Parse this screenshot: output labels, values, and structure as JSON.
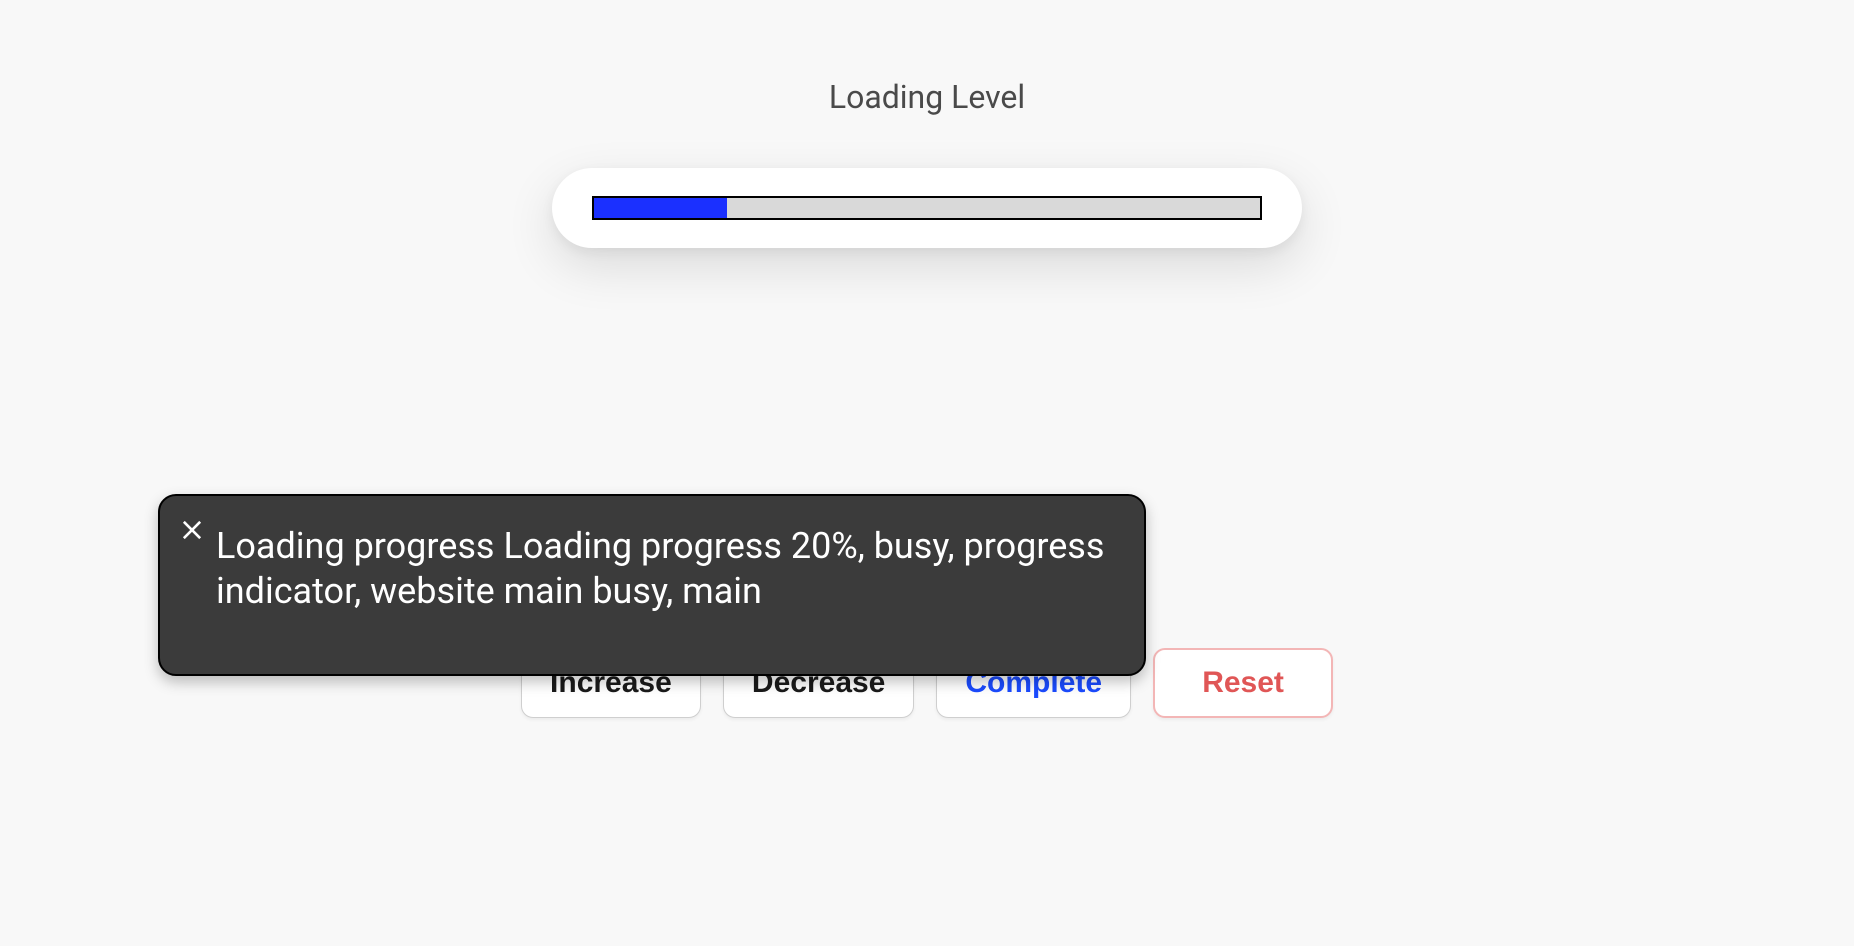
{
  "title": "Loading Level",
  "progress": {
    "percent": 20
  },
  "buttons": {
    "increase": "Increase",
    "decrease": "Decrease",
    "complete": "Complete",
    "reset": "Reset"
  },
  "tooltip": {
    "text": "Loading progress Loading progress 20%, busy, progress indicator, website main busy, main"
  }
}
